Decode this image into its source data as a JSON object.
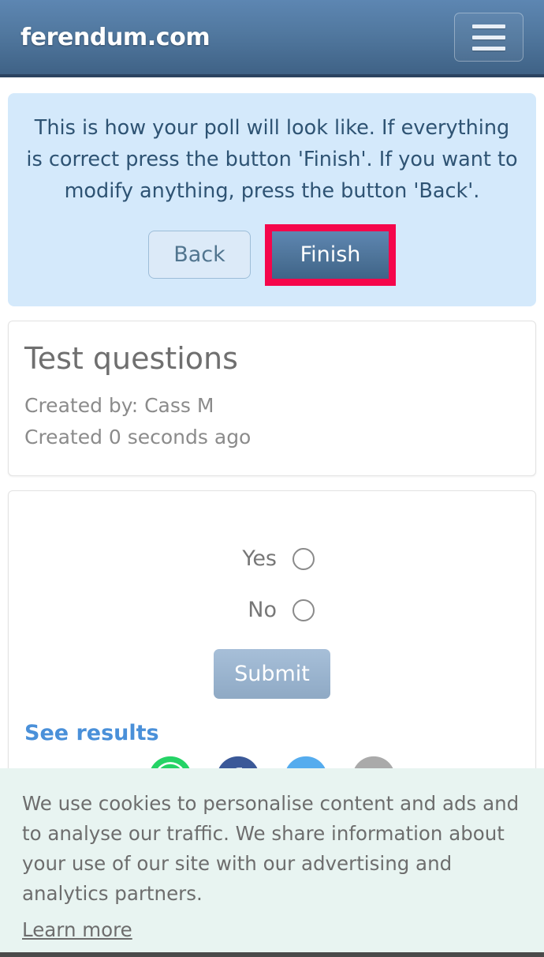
{
  "header": {
    "brand": "ferendum.com",
    "menu_icon": "hamburger-menu-icon"
  },
  "info_panel": {
    "message": "This is how your poll will look like. If everything is correct press the button 'Finish'. If you want to modify anything, press the button 'Back'.",
    "back_label": "Back",
    "finish_label": "Finish",
    "highlight_color": "#f5064b",
    "panel_color": "#d4e9fb",
    "text_color": "#2e5373"
  },
  "poll": {
    "title": "Test questions",
    "created_by": "Created by: Cass M",
    "created_ago": "Created 0 seconds ago",
    "options": [
      {
        "label": "Yes",
        "selected": false
      },
      {
        "label": "No",
        "selected": false
      }
    ],
    "submit_label": "Submit",
    "see_results_label": "See results",
    "see_results_color": "#4a90d9",
    "share": [
      {
        "name": "whatsapp-share-icon",
        "color": "#25d366"
      },
      {
        "name": "facebook-share-icon",
        "color": "#3b5998"
      },
      {
        "name": "twitter-share-icon",
        "color": "#55acee"
      },
      {
        "name": "email-share-icon",
        "color": "#aaaaaa"
      }
    ]
  },
  "cookie_banner": {
    "text": "We use cookies to personalise content and ads and to analyse our traffic. We share information about your use of our site with our advertising and analytics partners.",
    "link_label": "Learn more"
  }
}
